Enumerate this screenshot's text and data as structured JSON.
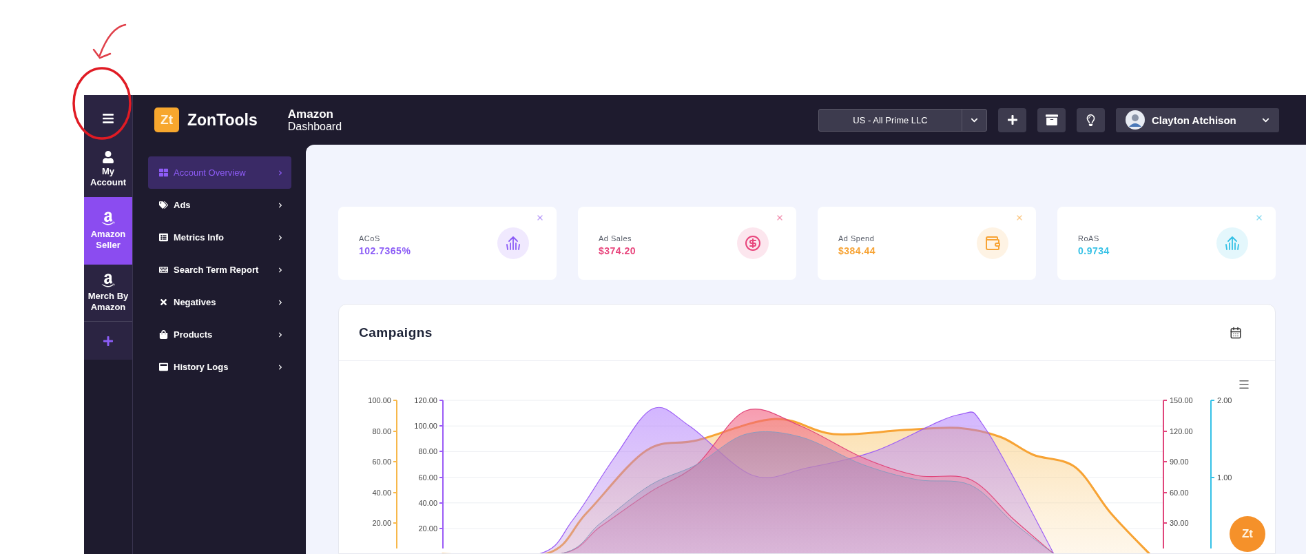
{
  "rail": {
    "items": [
      {
        "label": "My Account",
        "selected": false
      },
      {
        "label": "Amazon Seller",
        "selected": true
      },
      {
        "label": "Merch By Amazon",
        "selected": false
      }
    ]
  },
  "brand": {
    "logo": "Zt",
    "name": "ZonTools"
  },
  "page_title": {
    "line1": "Amazon",
    "line2": "Dashboard"
  },
  "account_select": {
    "value": "US - All Prime LLC"
  },
  "user": {
    "name": "Clayton Atchison"
  },
  "nav": [
    {
      "label": "Account Overview",
      "selected": true
    },
    {
      "label": "Ads",
      "selected": false
    },
    {
      "label": "Metrics Info",
      "selected": false
    },
    {
      "label": "Search Term Report",
      "selected": false
    },
    {
      "label": "Negatives",
      "selected": false
    },
    {
      "label": "Products",
      "selected": false
    },
    {
      "label": "History Logs",
      "selected": false
    }
  ],
  "stats": [
    {
      "label": "ACoS",
      "value": "102.7365%",
      "color": "#8b5cf6"
    },
    {
      "label": "Ad Sales",
      "value": "$374.20",
      "color": "#e8457c"
    },
    {
      "label": "Ad Spend",
      "value": "$384.44",
      "color": "#f7a334"
    },
    {
      "label": "RoAS",
      "value": "0.9734",
      "color": "#35c1e6"
    }
  ],
  "campaigns": {
    "title": "Campaigns",
    "axes": [
      {
        "color": "#f7b84b",
        "ticks": [
          "100.00",
          "80.00",
          "60.00",
          "40.00",
          "20.00"
        ]
      },
      {
        "color": "#9b5cf6",
        "ticks": [
          "120.00",
          "100.00",
          "80.00",
          "60.00",
          "40.00",
          "20.00"
        ]
      },
      {
        "color": "#e0457b",
        "ticks": [
          "150.00",
          "120.00",
          "90.00",
          "60.00",
          "30.00"
        ]
      },
      {
        "color": "#35c1e6",
        "ticks": [
          "2.00",
          "1.00"
        ]
      }
    ]
  },
  "chat_button": {
    "label": "Zt"
  }
}
